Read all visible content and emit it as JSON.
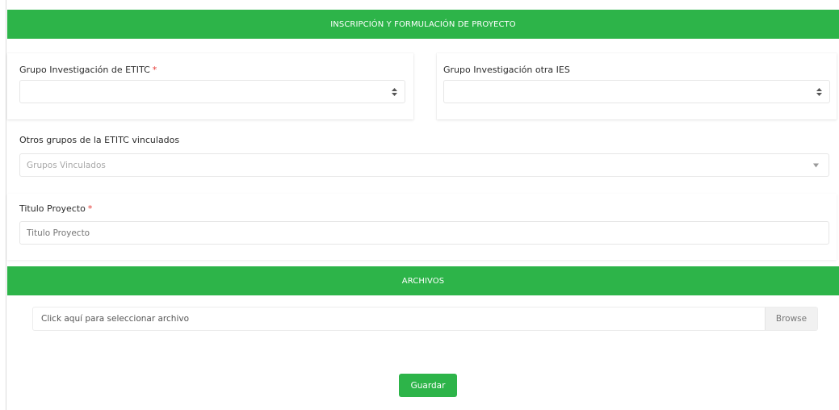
{
  "banners": {
    "registration": "INSCRIPCIÓN Y FORMULACIÓN DE PROYECTO",
    "files": "ARCHIVOS"
  },
  "form": {
    "grupo_etitc": {
      "label": "Grupo Investigación de ETITC",
      "required_mark": "*",
      "value": ""
    },
    "grupo_otra_ies": {
      "label": "Grupo Investigación otra IES",
      "value": ""
    },
    "otros_grupos": {
      "label": "Otros grupos de la ETITC vinculados",
      "placeholder": "Grupos Vinculados"
    },
    "titulo": {
      "label": "Titulo Proyecto",
      "required_mark": "*",
      "placeholder": "Titulo Proyecto"
    }
  },
  "files": {
    "placeholder": "Click aquí para seleccionar archivo",
    "browse_label": "Browse"
  },
  "actions": {
    "save_label": "Guardar"
  },
  "colors": {
    "accent": "#2db449",
    "required": "#e53935"
  }
}
